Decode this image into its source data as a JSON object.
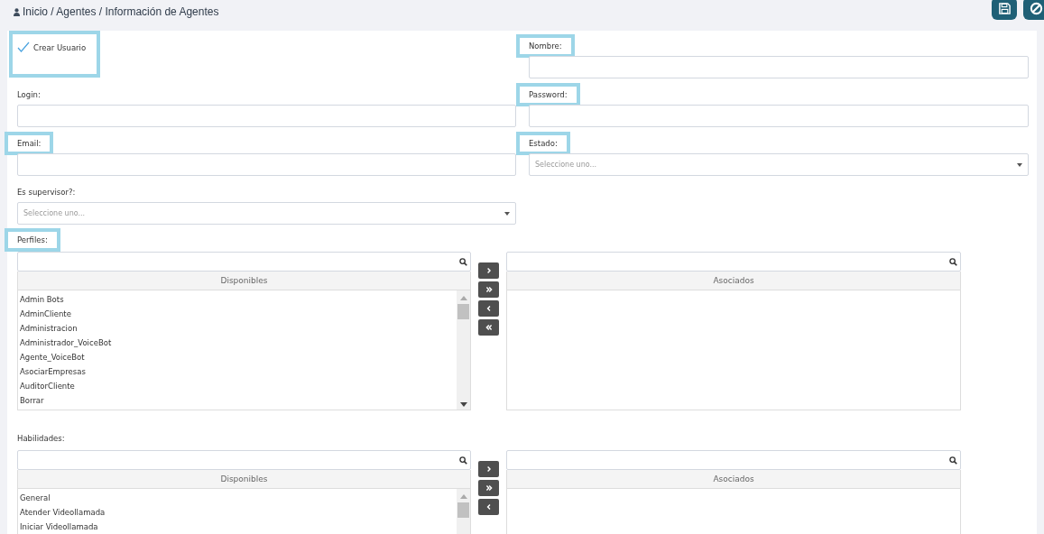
{
  "breadcrumb": "Inicio / Agentes / Información de Agentes",
  "toolbar": [
    {
      "kind": "save"
    },
    {
      "kind": "cancel"
    }
  ],
  "fields": [
    {
      "kind": "checkbox",
      "label": "Crear Usuario",
      "checked": true,
      "highlighted": true
    },
    {
      "kind": "text",
      "label": "Nombre:",
      "highlighted": true
    },
    {
      "kind": "text",
      "label": "Login:",
      "highlighted": false
    },
    {
      "kind": "password",
      "label": "Password:",
      "highlighted": true
    },
    {
      "kind": "text",
      "label": "Email:",
      "highlighted": true
    },
    {
      "kind": "select",
      "label": "Estado:",
      "placeholder": "Seleccione uno...",
      "highlighted": true
    },
    {
      "kind": "select",
      "label": "Es supervisor?:",
      "placeholder": "Seleccione uno...",
      "highlighted": false
    }
  ],
  "transfers": [
    {
      "label": "Perfiles:",
      "highlighted": true,
      "available_title": "Disponibles",
      "associated_title": "Asociados",
      "available": [
        "Admin Bots",
        "AdminCliente",
        "Administracion",
        "Administrador_VoiceBot",
        "Agente_VoiceBot",
        "AsociarEmpresas",
        "AuditorCliente",
        "Borrar"
      ],
      "move_buttons": [
        {
          "kind": "move_one"
        },
        {
          "kind": "move_all"
        },
        {
          "kind": "remove_one"
        },
        {
          "kind": "remove_all"
        }
      ]
    },
    {
      "label": "Habilidades:",
      "highlighted": false,
      "available_title": "Disponibles",
      "associated_title": "Asociados",
      "available": [
        "General",
        "Atender Videollamada",
        "Iniciar Videollamada"
      ],
      "move_buttons": [
        {
          "kind": "move_one"
        },
        {
          "kind": "move_all"
        },
        {
          "kind": "remove_one"
        }
      ]
    }
  ]
}
